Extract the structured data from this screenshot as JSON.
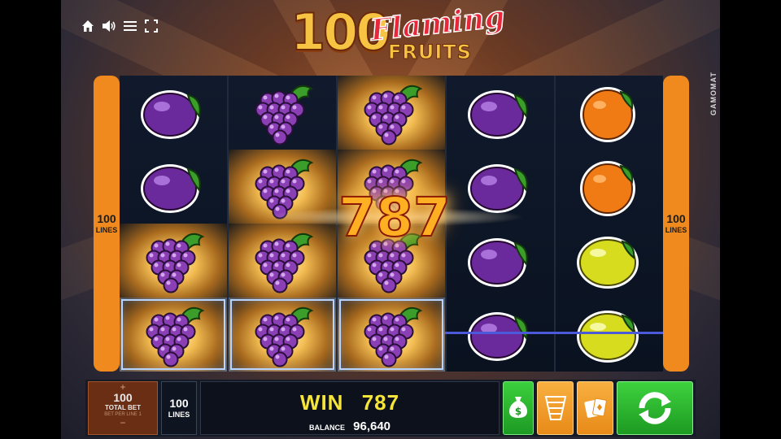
{
  "top_controls": {
    "icons": [
      "home-icon",
      "speaker-icon",
      "menu-icon",
      "fullscreen-icon"
    ]
  },
  "logo": {
    "number": "100",
    "word1": "Flaming",
    "word2": "FRUITS"
  },
  "provider": "GAMOMAT",
  "side_panels": {
    "left": {
      "value": "100",
      "label": "LINES"
    },
    "right": {
      "value": "100",
      "label": "LINES"
    }
  },
  "reels": [
    [
      "plum",
      "plum",
      "grapes",
      "grapes"
    ],
    [
      "grapes",
      "grapes",
      "grapes",
      "grapes"
    ],
    [
      "grapes",
      "grapes",
      "grapes",
      "grapes"
    ],
    [
      "plum",
      "plum",
      "plum",
      "plum"
    ],
    [
      "orange",
      "orange",
      "lemon",
      "lemon"
    ]
  ],
  "burning_cells": [
    [
      0,
      2
    ],
    [
      0,
      3
    ],
    [
      1,
      1
    ],
    [
      1,
      2
    ],
    [
      1,
      3
    ],
    [
      2,
      0
    ],
    [
      2,
      1
    ],
    [
      2,
      2
    ],
    [
      2,
      3
    ]
  ],
  "framed_cells": [
    [
      0,
      3
    ],
    [
      1,
      3
    ],
    [
      2,
      3
    ]
  ],
  "big_win": "787",
  "bottom_bar": {
    "bet_plus": "+",
    "bet_value": "100",
    "bet_label": "TOTAL BET",
    "bet_per_line": "BET PER LINE  1",
    "bet_minus": "−",
    "lines_value": "100",
    "lines_label": "LINES",
    "win_label": "WIN",
    "win_value": "787",
    "balance_label": "BALANCE",
    "balance_value": "96,640"
  },
  "colors": {
    "side_panel": "#f08a1e",
    "win_text": "#f5e43a",
    "spin_button": "#2fbf2f",
    "payline": "#4a5ad8"
  }
}
